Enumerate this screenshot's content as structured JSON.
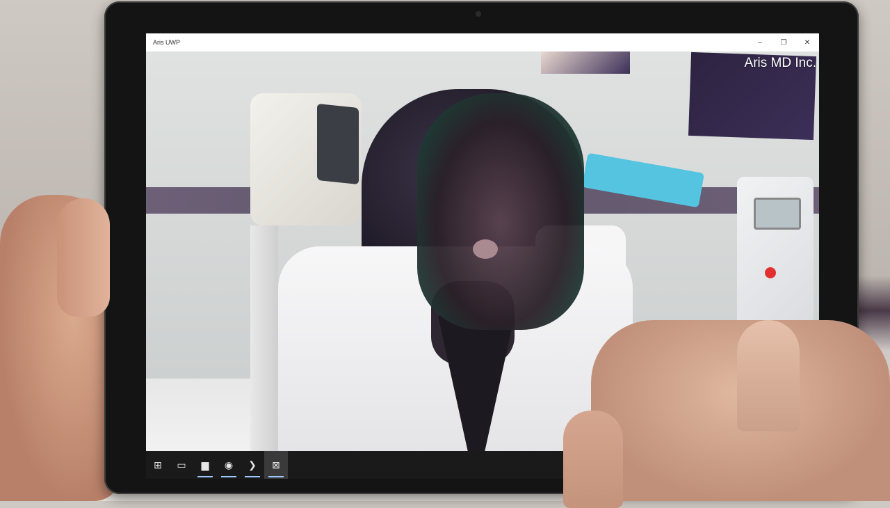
{
  "window": {
    "title": "Aris UWP",
    "controls": {
      "minimize": "–",
      "maximize": "❐",
      "close": "✕"
    }
  },
  "video": {
    "watermark": "Aris MD Inc."
  },
  "taskbar": {
    "items": [
      {
        "name": "start-icon",
        "glyph": "⊞"
      },
      {
        "name": "task-view-icon",
        "glyph": "▭"
      },
      {
        "name": "file-explorer-icon",
        "glyph": "▆"
      },
      {
        "name": "chrome-icon",
        "glyph": "◉"
      },
      {
        "name": "powershell-icon",
        "glyph": "❯"
      },
      {
        "name": "app-window-icon",
        "glyph": "⊠"
      }
    ]
  },
  "colors": {
    "titlebar": "#ffffff",
    "taskbar": "#1a1a1a",
    "bezel": "#141414",
    "accent": "#9ecbff"
  }
}
